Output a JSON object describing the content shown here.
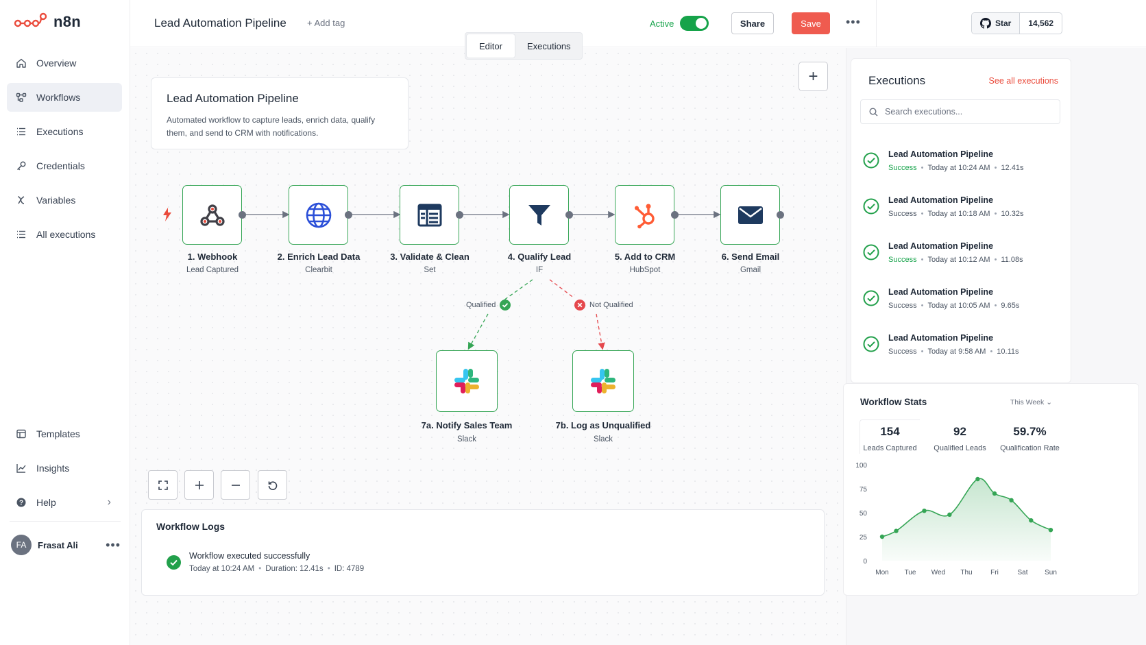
{
  "app": {
    "name": "n8n"
  },
  "sidebar": {
    "items": [
      {
        "label": "Overview",
        "icon": "home-icon"
      },
      {
        "label": "Workflows",
        "icon": "workflows-icon",
        "active": true
      },
      {
        "label": "Executions",
        "icon": "list-icon"
      },
      {
        "label": "Credentials",
        "icon": "key-icon"
      },
      {
        "label": "Variables",
        "icon": "variable-icon"
      },
      {
        "label": "All executions",
        "icon": "list-icon"
      }
    ],
    "bottom_items": [
      {
        "label": "Templates",
        "icon": "templates-icon"
      },
      {
        "label": "Insights",
        "icon": "chart-icon"
      },
      {
        "label": "Help",
        "icon": "help-icon"
      }
    ],
    "user": {
      "initials": "FA",
      "name": "Frasat Ali"
    }
  },
  "header": {
    "title": "Lead Automation Pipeline",
    "add_tag": "+ Add tag",
    "active_label": "Active",
    "active": true,
    "share_label": "Share",
    "save_label": "Save",
    "star_label": "Star",
    "star_count": "14,562"
  },
  "tabs": [
    {
      "label": "Editor",
      "active": true
    },
    {
      "label": "Executions",
      "active": false
    }
  ],
  "note": {
    "title": "Lead Automation Pipeline",
    "description": "Automated workflow to capture leads, enrich data, qualify them, and send to CRM with notifications."
  },
  "nodes": [
    {
      "label": "1. Webhook",
      "sub": "Lead Captured",
      "icon": "webhook-icon"
    },
    {
      "label": "2. Enrich Lead Data",
      "sub": "Clearbit",
      "icon": "globe-icon"
    },
    {
      "label": "3. Validate & Clean",
      "sub": "Set",
      "icon": "table-icon"
    },
    {
      "label": "4. Qualify Lead",
      "sub": "IF",
      "icon": "filter-icon"
    },
    {
      "label": "5. Add to CRM",
      "sub": "HubSpot",
      "icon": "hubspot-icon"
    },
    {
      "label": "6. Send Email",
      "sub": "Gmail",
      "icon": "mail-icon"
    },
    {
      "label": "7a. Notify Sales Team",
      "sub": "Slack",
      "icon": "slack-icon"
    },
    {
      "label": "7b. Log as Unqualified",
      "sub": "Slack",
      "icon": "slack-icon"
    }
  ],
  "branches": {
    "qualified": "Qualified",
    "not_qualified": "Not Qualified"
  },
  "logs": {
    "title": "Workflow Logs",
    "entry": {
      "message": "Workflow executed successfully",
      "time": "Today at 10:24 AM",
      "duration": "Duration: 12.41s",
      "id": "ID: 4789"
    }
  },
  "executions": {
    "title": "Executions",
    "see_all": "See all executions",
    "search_placeholder": "Search executions...",
    "items": [
      {
        "name": "Lead Automation Pipeline",
        "status": "Success",
        "status_green": true,
        "time": "Today at 10:24 AM",
        "duration": "12.41s"
      },
      {
        "name": "Lead Automation Pipeline",
        "status": "Success",
        "status_green": false,
        "time": "Today at 10:18 AM",
        "duration": "10.32s"
      },
      {
        "name": "Lead Automation Pipeline",
        "status": "Success",
        "status_green": true,
        "time": "Today at 10:12 AM",
        "duration": "11.08s"
      },
      {
        "name": "Lead Automation Pipeline",
        "status": "Success",
        "status_green": false,
        "time": "Today at 10:05 AM",
        "duration": "9.65s"
      },
      {
        "name": "Lead Automation Pipeline",
        "status": "Success",
        "status_green": false,
        "time": "Today at 9:58 AM",
        "duration": "10.11s"
      }
    ]
  },
  "stats": {
    "title": "Workflow Stats",
    "range": "This Week",
    "items": [
      {
        "value": "154",
        "label": "Leads Captured"
      },
      {
        "value": "92",
        "label": "Qualified Leads"
      },
      {
        "value": "59.7%",
        "label": "Qualification Rate"
      }
    ]
  },
  "chart_data": {
    "type": "area",
    "categories": [
      "Mon",
      "Tue",
      "Wed",
      "Thu",
      "Fri",
      "Sat",
      "Sun"
    ],
    "x": [
      "Mon",
      "",
      "Tue",
      "",
      "Wed",
      "",
      "Thu",
      "",
      "Fri",
      "",
      "Sat",
      "",
      "Sun"
    ],
    "values": [
      25,
      31,
      52,
      48,
      85,
      70,
      63,
      42,
      32
    ],
    "points_x": [
      0,
      0.5,
      1.5,
      2.4,
      3.4,
      4.0,
      4.6,
      5.3,
      6.0
    ],
    "yticks": [
      0,
      25,
      50,
      75,
      100
    ],
    "ylim": [
      0,
      100
    ],
    "color": "#35a555"
  },
  "colors": {
    "accent": "#ea4b3c",
    "success": "#16a34a",
    "node_border": "#35a555"
  }
}
